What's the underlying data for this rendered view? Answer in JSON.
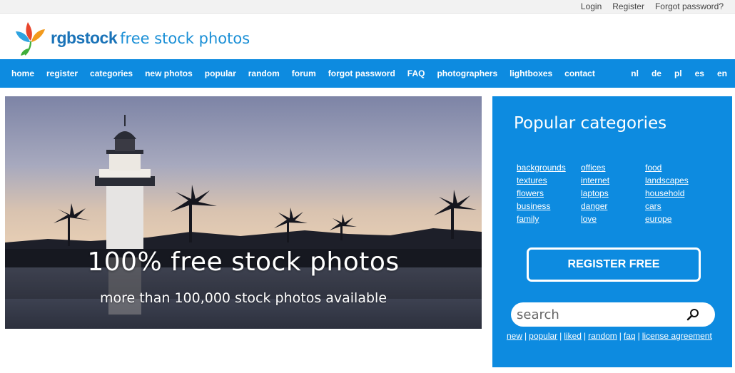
{
  "topbar": {
    "links": [
      "Login",
      "Register",
      "Forgot password?"
    ]
  },
  "header": {
    "brand_name": "rgbstock",
    "brand_tagline": "free stock photos"
  },
  "nav": {
    "items": [
      "home",
      "register",
      "categories",
      "new photos",
      "popular",
      "random",
      "forum",
      "forgot password",
      "FAQ",
      "photographers",
      "lightboxes",
      "contact"
    ],
    "languages": [
      "nl",
      "de",
      "pl",
      "es",
      "en"
    ]
  },
  "hero": {
    "title": "100% free stock photos",
    "subtitle": "more than 100,000 stock photos available"
  },
  "panel": {
    "heading": "Popular categories",
    "categories": [
      "backgrounds",
      "offices",
      "food",
      "textures",
      "internet",
      "landscapes",
      "flowers",
      "laptops",
      "household",
      "business",
      "danger",
      "cars",
      "family",
      "love",
      "europe"
    ],
    "register_label": "REGISTER FREE",
    "search_placeholder": "search",
    "sublinks": [
      "new",
      "popular",
      "liked",
      "random",
      "faq",
      "license agreement"
    ]
  },
  "colors": {
    "brand_blue": "#0d8be0",
    "logo_text": "#1a73b8"
  }
}
